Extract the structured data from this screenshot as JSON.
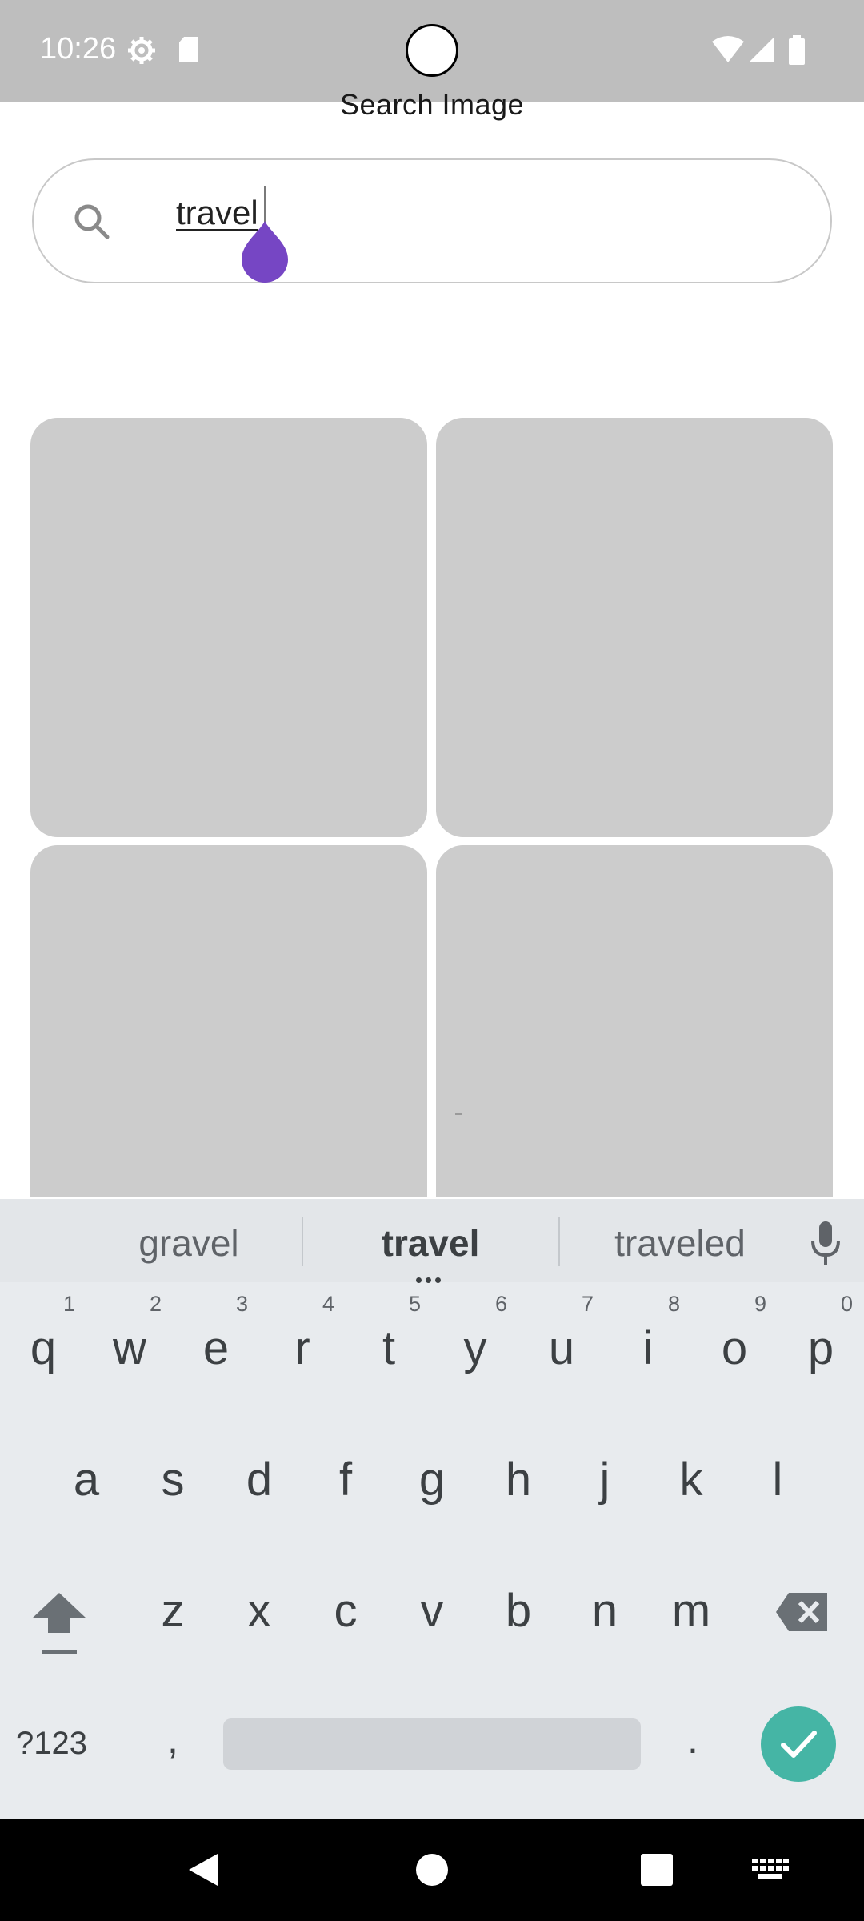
{
  "status_bar": {
    "time": "10:26",
    "icons": [
      "settings-gear-icon",
      "sd-card-icon",
      "wifi-icon",
      "cell-signal-icon",
      "battery-icon"
    ]
  },
  "page": {
    "title": "Search Image"
  },
  "search": {
    "value": "travel",
    "icon": "search-icon"
  },
  "results_grid": {
    "tiles": [
      {
        "color": "#cccccc"
      },
      {
        "color": "#cccccc"
      },
      {
        "color": "#cccccc"
      },
      {
        "color": "#cccccc"
      }
    ]
  },
  "keyboard": {
    "suggestions": [
      "gravel",
      "travel",
      "traveled"
    ],
    "row1": [
      {
        "key": "q",
        "hint": "1"
      },
      {
        "key": "w",
        "hint": "2"
      },
      {
        "key": "e",
        "hint": "3"
      },
      {
        "key": "r",
        "hint": "4"
      },
      {
        "key": "t",
        "hint": "5"
      },
      {
        "key": "y",
        "hint": "6"
      },
      {
        "key": "u",
        "hint": "7"
      },
      {
        "key": "i",
        "hint": "8"
      },
      {
        "key": "o",
        "hint": "9"
      },
      {
        "key": "p",
        "hint": "0"
      }
    ],
    "row2": [
      "a",
      "s",
      "d",
      "f",
      "g",
      "h",
      "j",
      "k",
      "l"
    ],
    "row3": [
      "z",
      "x",
      "c",
      "v",
      "b",
      "n",
      "m"
    ],
    "symbols_label": "?123",
    "comma": ",",
    "period": ".",
    "accent_color": "#45b5a5"
  },
  "nav_bar": {
    "icons": [
      "back-icon",
      "home-icon",
      "recents-icon",
      "keyboard-switch-icon"
    ]
  },
  "colors": {
    "status_bar": "#bebebe",
    "handle": "#7646c4"
  }
}
